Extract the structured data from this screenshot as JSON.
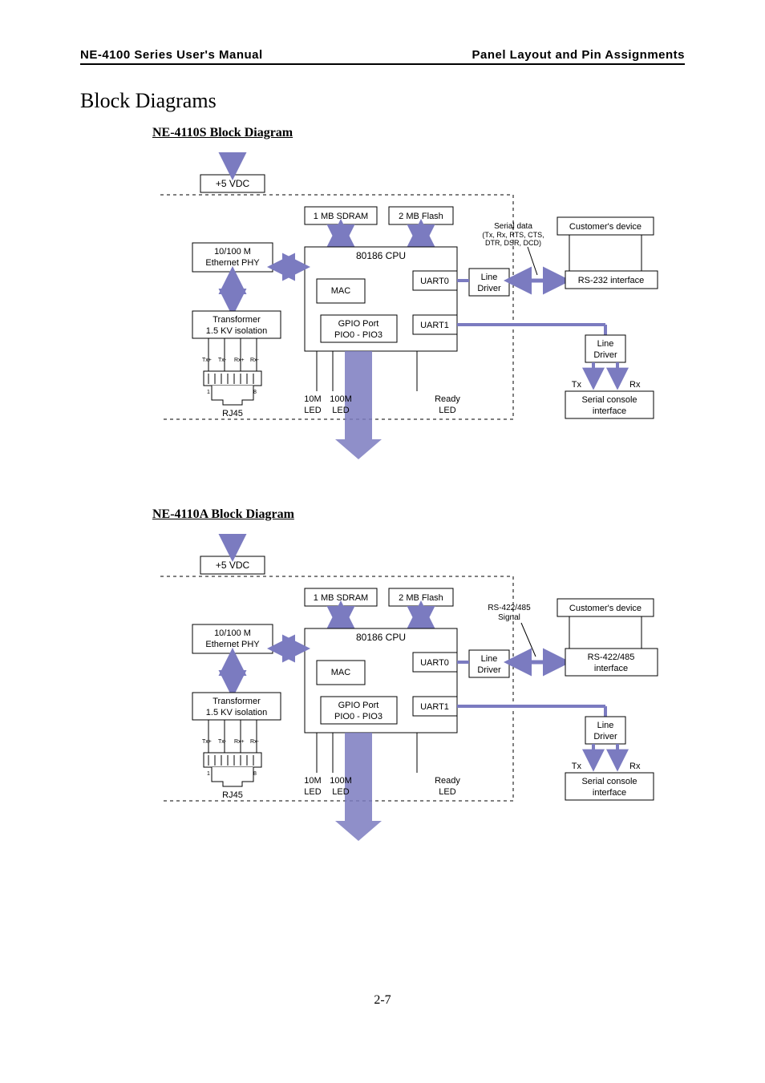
{
  "header": {
    "left": "NE-4100 Series User's Manual",
    "right": "Panel Layout and Pin Assignments"
  },
  "section_title": "Block Diagrams",
  "page_number": "2-7",
  "diagrams": [
    {
      "title": "NE-4110S Block Diagram",
      "power": "+5 VDC",
      "sdram": "1 MB SDRAM",
      "flash": "2 MB Flash",
      "cpu": "80186 CPU",
      "mac": "MAC",
      "uart0": "UART0",
      "uart1": "UART1",
      "gpio_l1": "GPIO Port",
      "gpio_l2": "PIO0 - PIO3",
      "phy_l1": "10/100 M",
      "phy_l2": "Ethernet PHY",
      "xfmr_l1": "Transformer",
      "xfmr_l2": "1.5 KV isolation",
      "rj45": "RJ45",
      "led10": "10M",
      "led100": "100M",
      "led_l": "LED",
      "ready_l1": "Ready",
      "ready_l2": "LED",
      "line_driver_l1": "Line",
      "line_driver_l2": "Driver",
      "signal_l1": "Serial data",
      "signal_l2": "(Tx, Rx, RTS, CTS,",
      "signal_l3": "DTR, DSR, DCD)",
      "cust": "Customer's device",
      "iface": "RS-232 interface",
      "serial_console_l1": "Serial console",
      "serial_console_l2": "interface",
      "tx": "Tx",
      "rx": "Rx",
      "txp": "Tx+",
      "txm": "Tx-",
      "rxp": "Rx+",
      "rxm": "Rx-",
      "pin1": "1",
      "pin8": "8"
    },
    {
      "title": "NE-4110A Block Diagram",
      "power": "+5 VDC",
      "sdram": "1 MB SDRAM",
      "flash": "2 MB Flash",
      "cpu": "80186 CPU",
      "mac": "MAC",
      "uart0": "UART0",
      "uart1": "UART1",
      "gpio_l1": "GPIO Port",
      "gpio_l2": "PIO0 - PIO3",
      "phy_l1": "10/100 M",
      "phy_l2": "Ethernet PHY",
      "xfmr_l1": "Transformer",
      "xfmr_l2": "1.5 KV isolation",
      "rj45": "RJ45",
      "led10": "10M",
      "led100": "100M",
      "led_l": "LED",
      "ready_l1": "Ready",
      "ready_l2": "LED",
      "line_driver_l1": "Line",
      "line_driver_l2": "Driver",
      "signal_l1": "RS-422/485",
      "signal_l2": "Signal",
      "signal_l3": "",
      "cust": "Customer's device",
      "iface_l1": "RS-422/485",
      "iface_l2": "interface",
      "serial_console_l1": "Serial console",
      "serial_console_l2": "interface",
      "tx": "Tx",
      "rx": "Rx",
      "txp": "Tx+",
      "txm": "Tx-",
      "rxp": "Rx+",
      "rxm": "Rx-",
      "pin1": "1",
      "pin8": "8"
    }
  ]
}
